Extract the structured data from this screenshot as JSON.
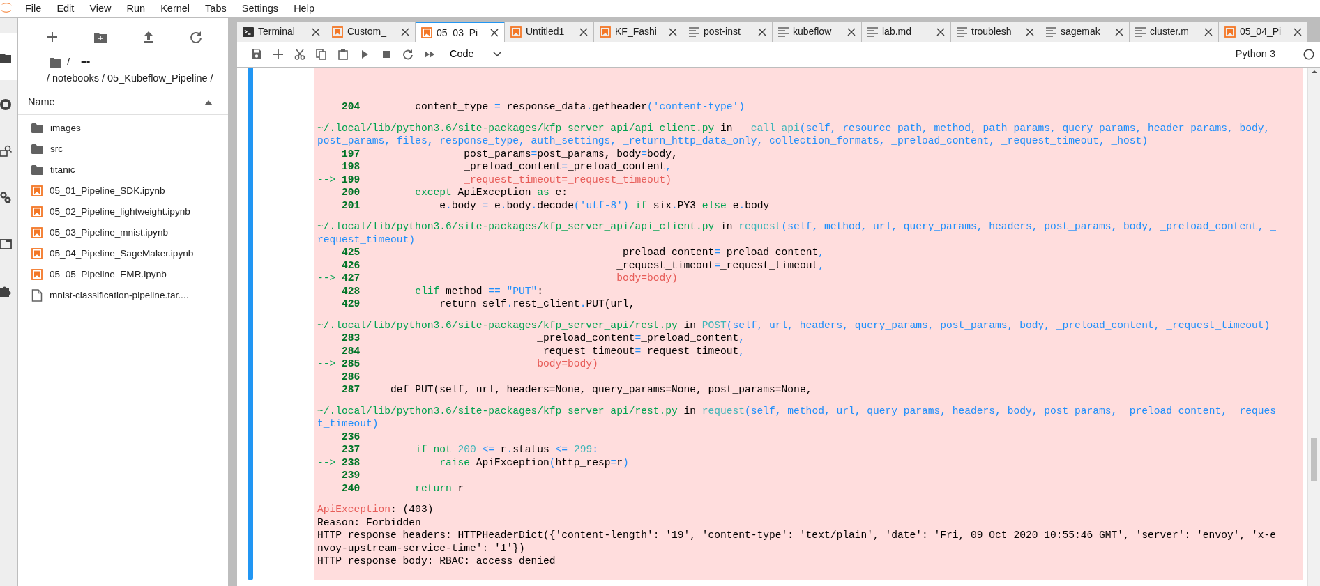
{
  "menu": [
    "File",
    "Edit",
    "View",
    "Run",
    "Kernel",
    "Tabs",
    "Settings",
    "Help"
  ],
  "activity_bar": [
    {
      "kind": "folder",
      "selected": true
    },
    {
      "kind": "running",
      "selected": false
    },
    {
      "kind": "inspector",
      "selected": false
    },
    {
      "kind": "gears",
      "selected": false
    },
    {
      "kind": "tabs",
      "selected": false
    },
    {
      "kind": "puzzle",
      "selected": false
    }
  ],
  "file_browser": {
    "breadcrumb_root": "/",
    "breadcrumb_more": "•••",
    "path": "/ notebooks / 05_Kubeflow_Pipeline /",
    "column": "Name",
    "files": [
      {
        "name": "images",
        "kind": "folder"
      },
      {
        "name": "src",
        "kind": "folder"
      },
      {
        "name": "titanic",
        "kind": "folder"
      },
      {
        "name": "05_01_Pipeline_SDK.ipynb",
        "kind": "notebook"
      },
      {
        "name": "05_02_Pipeline_lightweight.ipynb",
        "kind": "notebook"
      },
      {
        "name": "05_03_Pipeline_mnist.ipynb",
        "kind": "notebook"
      },
      {
        "name": "05_04_Pipeline_SageMaker.ipynb",
        "kind": "notebook"
      },
      {
        "name": "05_05_Pipeline_EMR.ipynb",
        "kind": "notebook"
      },
      {
        "name": "mnist-classification-pipeline.tar....",
        "kind": "file"
      }
    ]
  },
  "tabs": [
    {
      "label": "Terminal",
      "kind": "terminal",
      "selected": false
    },
    {
      "label": "Custom_",
      "kind": "notebook",
      "selected": false
    },
    {
      "label": "05_03_Pi",
      "kind": "notebook",
      "selected": true
    },
    {
      "label": "Untitled1",
      "kind": "notebook",
      "selected": false
    },
    {
      "label": "KF_Fashi",
      "kind": "notebook",
      "selected": false
    },
    {
      "label": "post-inst",
      "kind": "text",
      "selected": false
    },
    {
      "label": "kubeflow",
      "kind": "text",
      "selected": false
    },
    {
      "label": "lab.md",
      "kind": "text",
      "selected": false
    },
    {
      "label": "troublesh",
      "kind": "text",
      "selected": false
    },
    {
      "label": "sagemak",
      "kind": "text",
      "selected": false
    },
    {
      "label": "cluster.m",
      "kind": "text",
      "selected": false
    },
    {
      "label": "05_04_Pi",
      "kind": "notebook",
      "selected": false
    }
  ],
  "toolbar": {
    "cell_type": "Code",
    "kernel": "Python 3"
  },
  "output": [
    {
      "kind": "code",
      "number": "204",
      "tokens": [
        {
          "kind": "plain",
          "text": "         content_type "
        },
        {
          "kind": "operator",
          "text": "="
        },
        {
          "kind": "plain",
          "text": " response_data"
        },
        {
          "kind": "operator",
          "text": "."
        },
        {
          "kind": "plain",
          "text": "getheader"
        },
        {
          "kind": "operator",
          "text": "("
        },
        {
          "kind": "string",
          "text": "'content-type'"
        },
        {
          "kind": "operator",
          "text": ")"
        }
      ]
    },
    {
      "kind": "blank"
    },
    {
      "kind": "text",
      "tokens": [
        {
          "kind": "path",
          "text": "~/.local/lib/python3.6/site-packages/kfp_server_api/api_client.py"
        },
        {
          "kind": "plain",
          "text": " in "
        },
        {
          "kind": "function",
          "text": "__call_api"
        },
        {
          "kind": "args",
          "text": "(self, resource_path, method, path_params, query_params, header_params, body,"
        }
      ]
    },
    {
      "kind": "text",
      "tokens": [
        {
          "kind": "args",
          "text": "post_params, files, response_type, auth_settings, _return_http_data_only, collection_formats, _preload_content, _request_timeout, _host)"
        }
      ]
    },
    {
      "kind": "code",
      "number": "197",
      "tokens": [
        {
          "kind": "plain",
          "text": "                 post_params"
        },
        {
          "kind": "operator",
          "text": "="
        },
        {
          "kind": "plain",
          "text": "post_params, body"
        },
        {
          "kind": "operator",
          "text": "="
        },
        {
          "kind": "plain",
          "text": "body,"
        }
      ]
    },
    {
      "kind": "code",
      "number": "198",
      "tokens": [
        {
          "kind": "plain",
          "text": "                 _preload_content"
        },
        {
          "kind": "operator",
          "text": "="
        },
        {
          "kind": "plain",
          "text": "_preload_content"
        },
        {
          "kind": "operator",
          "text": ","
        }
      ]
    },
    {
      "kind": "code",
      "marker": "-->",
      "number": "199",
      "tokens": [
        {
          "kind": "error",
          "text": "                 _request_timeout=_request_timeout)"
        }
      ]
    },
    {
      "kind": "code",
      "number": "200",
      "tokens": [
        {
          "kind": "keyword",
          "text": "         except"
        },
        {
          "kind": "plain",
          "text": " ApiException "
        },
        {
          "kind": "keyword",
          "text": "as"
        },
        {
          "kind": "plain",
          "text": " e:"
        }
      ]
    },
    {
      "kind": "code",
      "number": "201",
      "tokens": [
        {
          "kind": "plain",
          "text": "             e"
        },
        {
          "kind": "operator",
          "text": "."
        },
        {
          "kind": "plain",
          "text": "body "
        },
        {
          "kind": "operator",
          "text": "="
        },
        {
          "kind": "plain",
          "text": " e"
        },
        {
          "kind": "operator",
          "text": "."
        },
        {
          "kind": "plain",
          "text": "body"
        },
        {
          "kind": "operator",
          "text": "."
        },
        {
          "kind": "plain",
          "text": "decode"
        },
        {
          "kind": "operator",
          "text": "("
        },
        {
          "kind": "string",
          "text": "'utf-8'"
        },
        {
          "kind": "operator",
          "text": ")"
        },
        {
          "kind": "keyword",
          "text": " if"
        },
        {
          "kind": "plain",
          "text": " six"
        },
        {
          "kind": "operator",
          "text": "."
        },
        {
          "kind": "plain",
          "text": "PY3 "
        },
        {
          "kind": "keyword",
          "text": "else"
        },
        {
          "kind": "plain",
          "text": " e"
        },
        {
          "kind": "operator",
          "text": "."
        },
        {
          "kind": "plain",
          "text": "body"
        }
      ]
    },
    {
      "kind": "blank"
    },
    {
      "kind": "text",
      "tokens": [
        {
          "kind": "path",
          "text": "~/.local/lib/python3.6/site-packages/kfp_server_api/api_client.py"
        },
        {
          "kind": "plain",
          "text": " in "
        },
        {
          "kind": "function",
          "text": "request"
        },
        {
          "kind": "args",
          "text": "(self, method, url, query_params, headers, post_params, body, _preload_content, _"
        }
      ]
    },
    {
      "kind": "text",
      "tokens": [
        {
          "kind": "args",
          "text": "request_timeout)"
        }
      ]
    },
    {
      "kind": "code",
      "number": "425",
      "tokens": [
        {
          "kind": "plain",
          "text": "                                          _preload_content"
        },
        {
          "kind": "operator",
          "text": "="
        },
        {
          "kind": "plain",
          "text": "_preload_content"
        },
        {
          "kind": "operator",
          "text": ","
        }
      ]
    },
    {
      "kind": "code",
      "number": "426",
      "tokens": [
        {
          "kind": "plain",
          "text": "                                          _request_timeout"
        },
        {
          "kind": "operator",
          "text": "="
        },
        {
          "kind": "plain",
          "text": "_request_timeout"
        },
        {
          "kind": "operator",
          "text": ","
        }
      ]
    },
    {
      "kind": "code",
      "marker": "-->",
      "number": "427",
      "tokens": [
        {
          "kind": "error",
          "text": "                                          body=body)"
        }
      ]
    },
    {
      "kind": "code",
      "number": "428",
      "tokens": [
        {
          "kind": "keyword",
          "text": "         elif"
        },
        {
          "kind": "plain",
          "text": " method "
        },
        {
          "kind": "operator",
          "text": "=="
        },
        {
          "kind": "string",
          "text": " \"PUT\""
        },
        {
          "kind": "plain",
          "text": ":"
        }
      ]
    },
    {
      "kind": "code",
      "number": "429",
      "tokens": [
        {
          "kind": "plain",
          "text": "             return self"
        },
        {
          "kind": "operator",
          "text": "."
        },
        {
          "kind": "plain",
          "text": "rest_client"
        },
        {
          "kind": "operator",
          "text": "."
        },
        {
          "kind": "plain",
          "text": "PUT(url,"
        }
      ]
    },
    {
      "kind": "blank"
    },
    {
      "kind": "text",
      "tokens": [
        {
          "kind": "path",
          "text": "~/.local/lib/python3.6/site-packages/kfp_server_api/rest.py"
        },
        {
          "kind": "plain",
          "text": " in "
        },
        {
          "kind": "function",
          "text": "POST"
        },
        {
          "kind": "args",
          "text": "(self, url, headers, query_params, post_params, body, _preload_content, _request_timeout)"
        }
      ]
    },
    {
      "kind": "code",
      "number": "283",
      "tokens": [
        {
          "kind": "plain",
          "text": "                             _preload_content"
        },
        {
          "kind": "operator",
          "text": "="
        },
        {
          "kind": "plain",
          "text": "_preload_content"
        },
        {
          "kind": "operator",
          "text": ","
        }
      ]
    },
    {
      "kind": "code",
      "number": "284",
      "tokens": [
        {
          "kind": "plain",
          "text": "                             _request_timeout"
        },
        {
          "kind": "operator",
          "text": "="
        },
        {
          "kind": "plain",
          "text": "_request_timeout"
        },
        {
          "kind": "operator",
          "text": ","
        }
      ]
    },
    {
      "kind": "code",
      "marker": "-->",
      "number": "285",
      "tokens": [
        {
          "kind": "error",
          "text": "                             body=body)"
        }
      ]
    },
    {
      "kind": "code",
      "number": "286"
    },
    {
      "kind": "code",
      "number": "287",
      "tokens": [
        {
          "kind": "plain",
          "text": "     def PUT(self, url, headers=None, query_params=None, post_params=None,"
        }
      ]
    },
    {
      "kind": "blank"
    },
    {
      "kind": "text",
      "tokens": [
        {
          "kind": "path",
          "text": "~/.local/lib/python3.6/site-packages/kfp_server_api/rest.py"
        },
        {
          "kind": "plain",
          "text": " in "
        },
        {
          "kind": "function",
          "text": "request"
        },
        {
          "kind": "args",
          "text": "(self, method, url, query_params, headers, body, post_params, _preload_content, _reques"
        }
      ]
    },
    {
      "kind": "text",
      "tokens": [
        {
          "kind": "args",
          "text": "t_timeout)"
        }
      ]
    },
    {
      "kind": "code",
      "number": "236"
    },
    {
      "kind": "code",
      "number": "237",
      "tokens": [
        {
          "kind": "keyword",
          "text": "         if not"
        },
        {
          "kind": "number",
          "text": " 200"
        },
        {
          "kind": "operator",
          "text": " <="
        },
        {
          "kind": "plain",
          "text": " r"
        },
        {
          "kind": "operator",
          "text": "."
        },
        {
          "kind": "plain",
          "text": "status "
        },
        {
          "kind": "operator",
          "text": "<="
        },
        {
          "kind": "number",
          "text": " 299"
        },
        {
          "kind": "operator",
          "text": ":"
        }
      ]
    },
    {
      "kind": "code",
      "marker": "-->",
      "number": "238",
      "tokens": [
        {
          "kind": "keyword",
          "text": "             raise"
        },
        {
          "kind": "plain",
          "text": " ApiException"
        },
        {
          "kind": "operator",
          "text": "("
        },
        {
          "kind": "plain",
          "text": "http_resp"
        },
        {
          "kind": "operator",
          "text": "="
        },
        {
          "kind": "plain",
          "text": "r"
        },
        {
          "kind": "operator",
          "text": ")"
        }
      ]
    },
    {
      "kind": "code",
      "number": "239"
    },
    {
      "kind": "code",
      "number": "240",
      "tokens": [
        {
          "kind": "keyword",
          "text": "         return"
        },
        {
          "kind": "plain",
          "text": " r"
        }
      ]
    },
    {
      "kind": "blank"
    },
    {
      "kind": "text",
      "tokens": [
        {
          "kind": "error",
          "text": "ApiException"
        },
        {
          "kind": "plain",
          "text": ": (403)"
        }
      ]
    },
    {
      "kind": "text",
      "tokens": [
        {
          "kind": "plain",
          "text": "Reason: Forbidden"
        }
      ]
    },
    {
      "kind": "text",
      "tokens": [
        {
          "kind": "plain",
          "text": "HTTP response headers: HTTPHeaderDict({'content-length': '19', 'content-type': 'text/plain', 'date': 'Fri, 09 Oct 2020 10:55:46 GMT', 'server': 'envoy', 'x-e"
        }
      ]
    },
    {
      "kind": "text",
      "tokens": [
        {
          "kind": "plain",
          "text": "nvoy-upstream-service-time': '1'})"
        }
      ]
    },
    {
      "kind": "text",
      "tokens": [
        {
          "kind": "plain",
          "text": "HTTP response body: RBAC: access denied"
        }
      ]
    }
  ]
}
